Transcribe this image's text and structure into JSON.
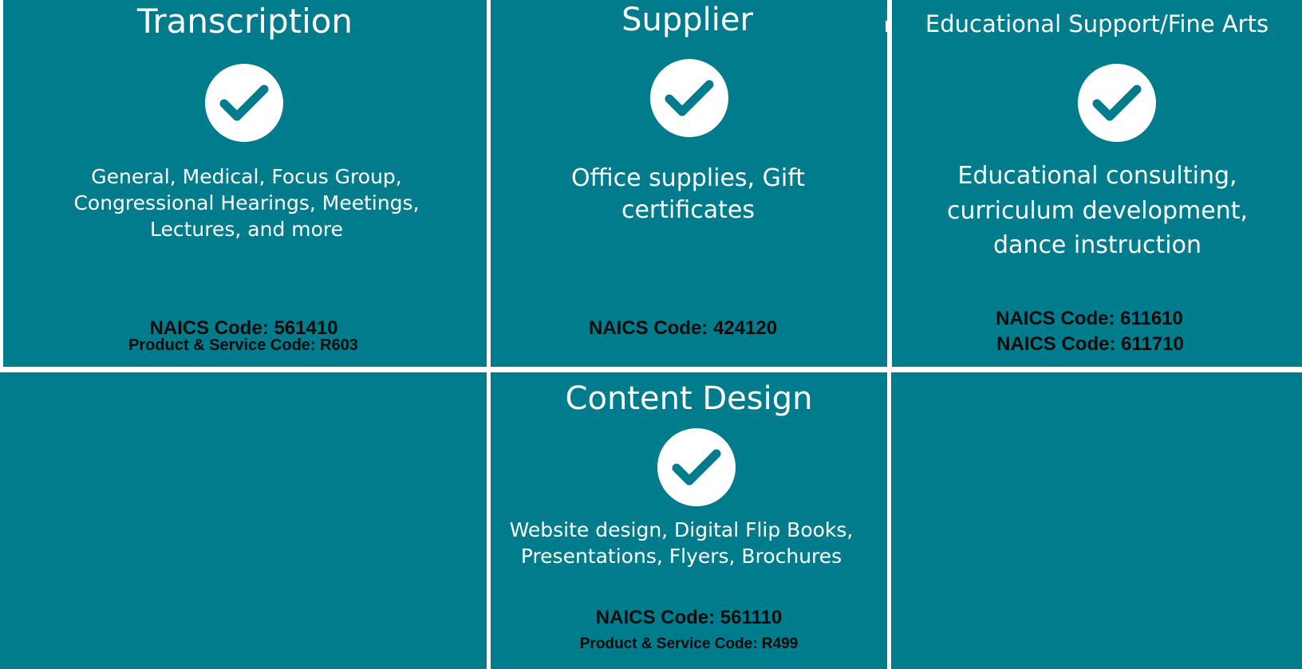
{
  "colors": {
    "panel_bg": "#007c8d",
    "text": "#ffffff",
    "code_text": "#0b0b0b",
    "gap": "#ffffff"
  },
  "icon": "check-circle-icon",
  "transcription": {
    "title": "Transcription",
    "description": "General, Medical, Focus Group, Congressional Hearings, Meetings, Lectures, and more",
    "naics": "NAICS Code: 561410",
    "psc": "Product & Service Code: R603"
  },
  "supplier": {
    "title": "Supplier",
    "description": "Office supplies, Gift certificates",
    "naics": "NAICS Code: 424120"
  },
  "educational": {
    "title": "Educational Support/Fine Arts",
    "description": "Educational consulting, curriculum development, dance instruction",
    "naics_1": "NAICS Code: 611610",
    "naics_2": "NAICS Code: 611710"
  },
  "content_design": {
    "title": "Content Design",
    "description": "Website design, Digital Flip Books, Presentations, Flyers, Brochures",
    "naics": "NAICS Code: 561110",
    "psc": "Product & Service Code: R499"
  }
}
